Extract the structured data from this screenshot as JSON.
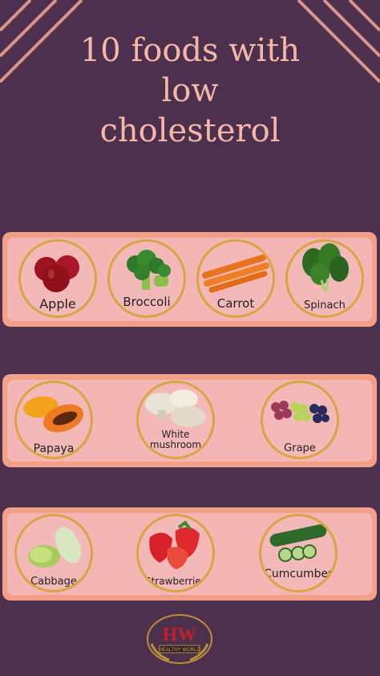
{
  "title": {
    "line1": "10 foods with",
    "line2": "low",
    "line3": "cholesterol"
  },
  "colors": {
    "background": "#4d2f4e",
    "band": "#f4a088",
    "card": "#f4b6b4",
    "ring": "#d9a441",
    "title": "#f4b8a8"
  },
  "rows": [
    {
      "items": [
        {
          "label": "Apple",
          "icon": "apple-icon"
        },
        {
          "label": "Broccoli",
          "icon": "broccoli-icon"
        },
        {
          "label": "Carrot",
          "icon": "carrot-icon"
        },
        {
          "label": "Spinach",
          "icon": "spinach-icon"
        }
      ]
    },
    {
      "items": [
        {
          "label": "Papaya",
          "icon": "papaya-icon"
        },
        {
          "label": "White",
          "label2": "mushroom",
          "icon": "mushroom-icon"
        },
        {
          "label": "Grape",
          "icon": "grape-icon"
        }
      ]
    },
    {
      "items": [
        {
          "label": "Cabbage",
          "icon": "cabbage-icon"
        },
        {
          "label": "Strawberries",
          "icon": "strawberry-icon"
        },
        {
          "label": "Cumcumber",
          "icon": "cucumber-icon"
        }
      ]
    }
  ],
  "logo": {
    "letters": "HW",
    "text": "HEALTHY WORLD"
  }
}
